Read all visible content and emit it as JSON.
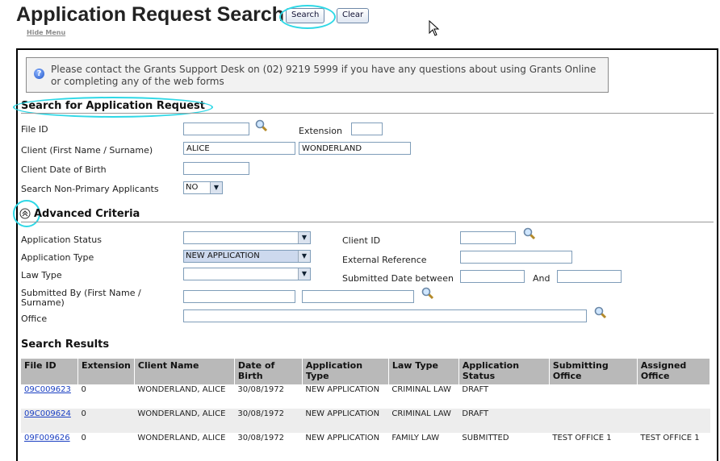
{
  "header": {
    "title": "Application Request Search",
    "search_label": "Search",
    "clear_label": "Clear",
    "hide_menu": "Hide Menu"
  },
  "info": {
    "text": "Please contact the Grants Support Desk on (02) 9219 5999 if you have any questions about using Grants Online or completing any of the web forms"
  },
  "search": {
    "heading": "Search for Application Request",
    "file_id_label": "File ID",
    "file_id_value": "",
    "extension_label": "Extension",
    "extension_value": "",
    "client_label": "Client (First Name / Surname)",
    "first_name": "ALICE",
    "surname": "WONDERLAND",
    "dob_label": "Client Date of Birth",
    "dob_value": "",
    "non_primary_label": "Search Non-Primary Applicants",
    "non_primary_value": "NO"
  },
  "advanced": {
    "heading": "Advanced Criteria",
    "status_label": "Application Status",
    "status_value": "",
    "type_label": "Application Type",
    "type_value": "NEW APPLICATION",
    "law_label": "Law Type",
    "law_value": "",
    "submitted_by_label": "Submitted By (First Name / Surname)",
    "office_label": "Office",
    "client_id_label": "Client ID",
    "ext_ref_label": "External Reference",
    "date_between_label": "Submitted Date between",
    "and_label": "And"
  },
  "results": {
    "heading": "Search Results",
    "columns": [
      "File ID",
      "Extension",
      "Client Name",
      "Date of Birth",
      "Application Type",
      "Law Type",
      "Application Status",
      "Submitting Office",
      "Assigned Office"
    ],
    "rows": [
      {
        "file_id": "09C009623",
        "extension": "0",
        "client": "WONDERLAND, ALICE",
        "dob": "30/08/1972",
        "type": "NEW APPLICATION",
        "law": "CRIMINAL LAW",
        "status": "DRAFT",
        "submitting": "",
        "assigned": ""
      },
      {
        "file_id": "09C009624",
        "extension": "0",
        "client": "WONDERLAND, ALICE",
        "dob": "30/08/1972",
        "type": "NEW APPLICATION",
        "law": "CRIMINAL LAW",
        "status": "DRAFT",
        "submitting": "",
        "assigned": ""
      },
      {
        "file_id": "09F009626",
        "extension": "0",
        "client": "WONDERLAND, ALICE",
        "dob": "30/08/1972",
        "type": "NEW APPLICATION",
        "law": "FAMILY LAW",
        "status": "SUBMITTED",
        "submitting": "TEST OFFICE 1",
        "assigned": "TEST OFFICE 1"
      }
    ]
  },
  "colors": {
    "highlight": "#2fd8e6",
    "header_bg": "#b9b9b9",
    "link": "#1a3fc2"
  },
  "icons": [
    "info-icon",
    "magnifier-icon",
    "collapse-icon",
    "pointer-cursor-icon"
  ]
}
